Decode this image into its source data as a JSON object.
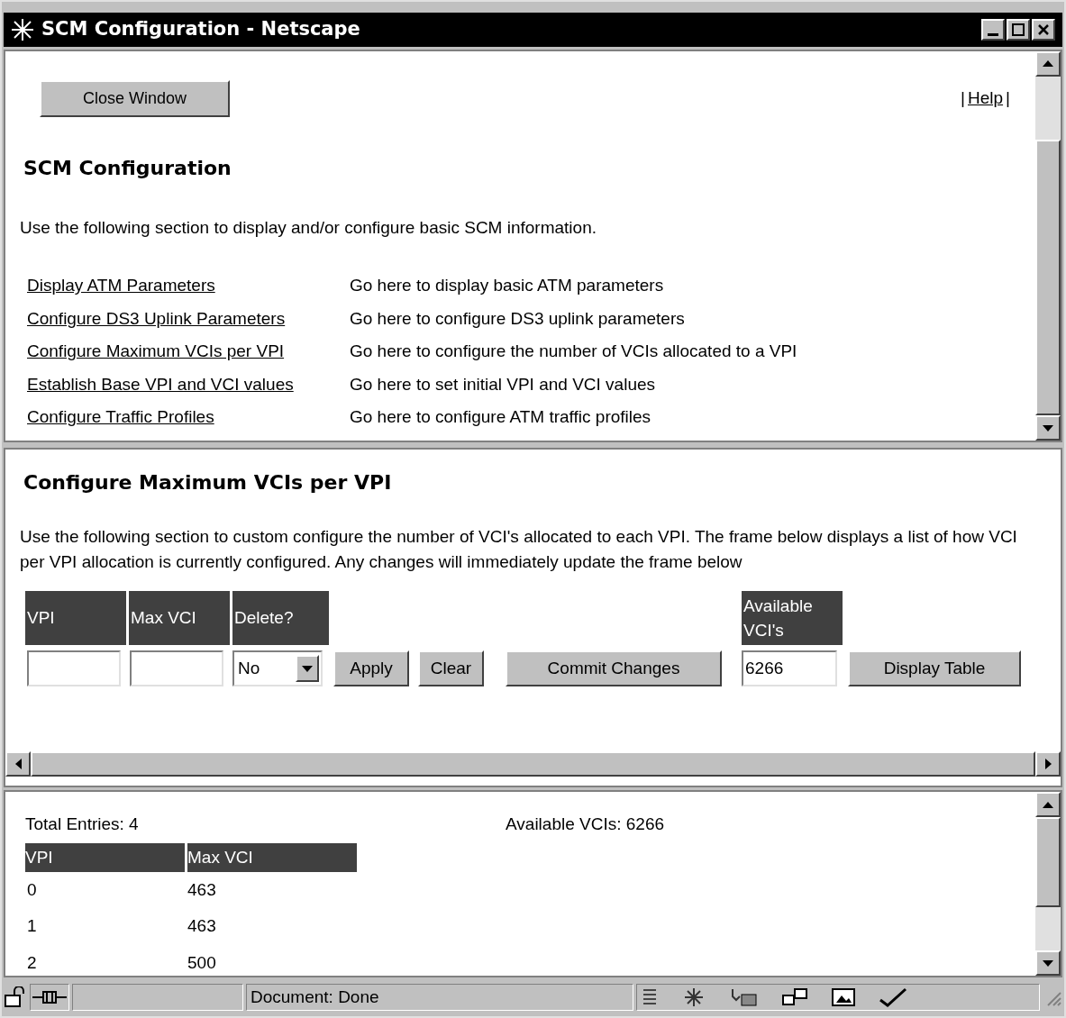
{
  "window": {
    "title": "SCM Configuration - Netscape"
  },
  "top_frame": {
    "close_button": "Close Window",
    "help_separators": [
      "|",
      "|"
    ],
    "help_link": "Help",
    "heading": "SCM Configuration",
    "intro": "Use the following section to display and/or configure basic SCM information.",
    "links": [
      {
        "label": "Display ATM Parameters",
        "description": "Go here to display basic ATM parameters"
      },
      {
        "label": "Configure DS3 Uplink Parameters",
        "description": "Go here to configure DS3 uplink parameters"
      },
      {
        "label": "Configure Maximum VCIs per VPI",
        "description": "Go here to configure the number of VCIs allocated to a VPI"
      },
      {
        "label": "Establish Base VPI and VCI values",
        "description": "Go here to set initial VPI and VCI values"
      },
      {
        "label": "Configure Traffic Profiles",
        "description": "Go here to configure ATM traffic profiles"
      }
    ]
  },
  "middle_frame": {
    "heading": "Configure Maximum VCIs per VPI",
    "description": "Use the following section to custom configure the number of VCI's allocated to each VPI. The frame below displays a list of how VCI per VPI allocation is currently configured. Any changes will immediately update the frame below",
    "form": {
      "columns": [
        "VPI",
        "Max VCI",
        "Delete?"
      ],
      "delete_value": "No",
      "buttons": [
        "Apply",
        "Clear",
        "Commit Changes"
      ],
      "available_label": "Available VCI's",
      "available_value": "6266",
      "display_button": "Display Table"
    }
  },
  "bottom_frame": {
    "total_entries": "Total Entries: 4",
    "available": "Available VCIs: 6266",
    "columns": [
      "VPI",
      "Max VCI"
    ],
    "rows": [
      [
        "0",
        "463"
      ],
      [
        "1",
        "463"
      ],
      [
        "2",
        "500"
      ]
    ]
  },
  "status_bar": {
    "text": "Document: Done"
  }
}
